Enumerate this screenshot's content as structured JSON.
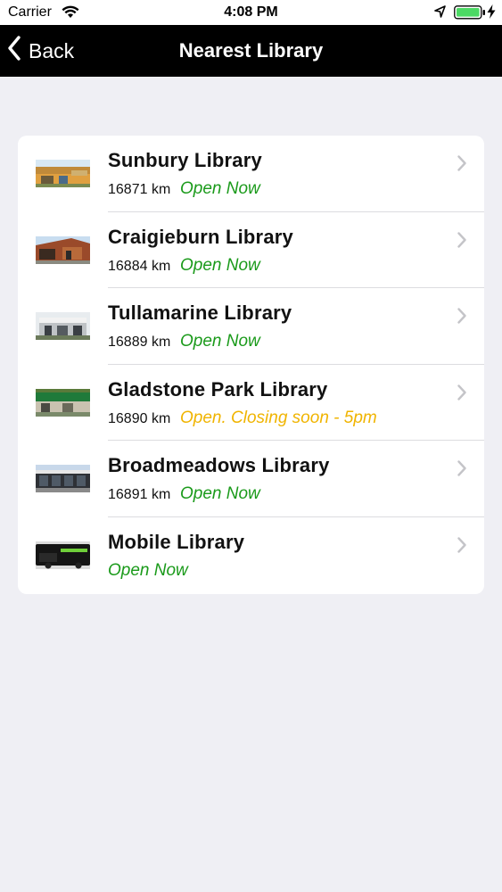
{
  "status_bar": {
    "carrier": "Carrier",
    "time": "4:08 PM",
    "icons": [
      "wifi-icon",
      "location-arrow-icon",
      "battery-icon",
      "charging-bolt-icon"
    ]
  },
  "nav": {
    "back_label": "Back",
    "title": "Nearest Library"
  },
  "colors": {
    "open": "#1a9a1a",
    "closing_soon": "#f0b400",
    "nav_background": "#000000",
    "page_background": "#efeff4"
  },
  "libraries": [
    {
      "name": "Sunbury Library",
      "distance": "16871 km",
      "status": "Open Now",
      "status_kind": "open",
      "thumb_icon": "library-photo"
    },
    {
      "name": "Craigieburn Library",
      "distance": "16884 km",
      "status": "Open Now",
      "status_kind": "open",
      "thumb_icon": "library-photo"
    },
    {
      "name": "Tullamarine Library",
      "distance": "16889 km",
      "status": "Open Now",
      "status_kind": "open",
      "thumb_icon": "library-photo"
    },
    {
      "name": "Gladstone Park Library",
      "distance": "16890 km",
      "status": "Open. Closing soon - 5pm",
      "status_kind": "closing",
      "thumb_icon": "library-photo"
    },
    {
      "name": "Broadmeadows Library",
      "distance": "16891 km",
      "status": "Open Now",
      "status_kind": "open",
      "thumb_icon": "library-photo"
    },
    {
      "name": "Mobile Library",
      "distance": "",
      "status": "Open Now",
      "status_kind": "open",
      "thumb_icon": "library-photo"
    }
  ]
}
